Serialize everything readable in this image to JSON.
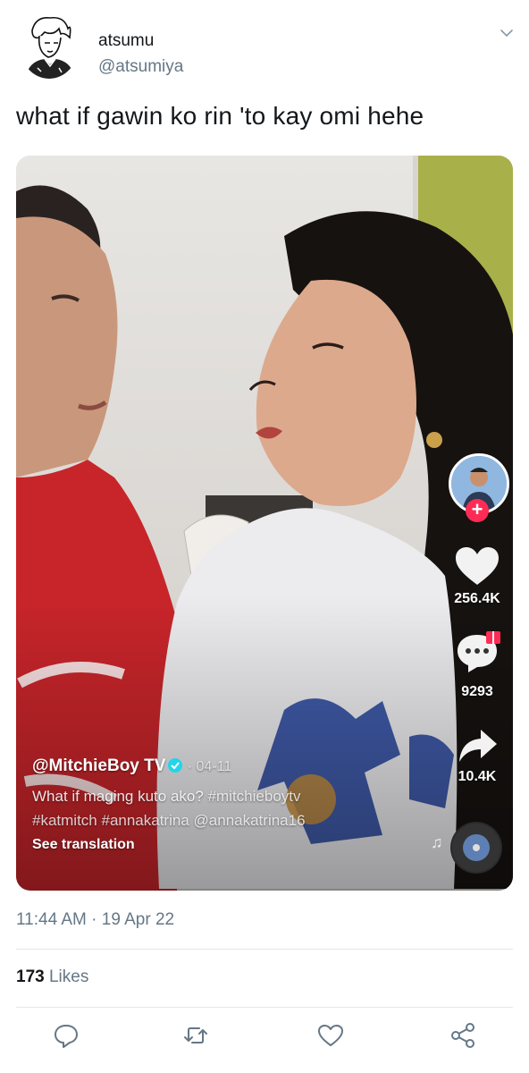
{
  "tweet": {
    "display_name": "atsumu",
    "handle": "@atsumiya",
    "text": "what if gawin ko rin 'to kay omi hehe",
    "timestamp": "11:44 AM · 19 Apr 22",
    "likes_count": "173",
    "likes_label": "Likes"
  },
  "video": {
    "username": "@MitchieBoy TV",
    "date": "· 04-11",
    "caption_text": "What if maging kuto ako?",
    "caption_tags": [
      "#mitchieboytv",
      "#katmitch",
      "#annakatrina",
      "@annakatrina16"
    ],
    "see_translation": "See translation",
    "like_count": "256.4K",
    "comment_count": "9293",
    "share_count": "10.4K"
  },
  "icons": {
    "chevron": "chevron-down-icon",
    "reply": "reply-icon",
    "retweet": "retweet-icon",
    "like": "heart-icon",
    "share": "share-icon"
  },
  "colors": {
    "muted_text": "#657786",
    "tiktok_red": "#fe2c55",
    "verified": "#20d5ec"
  }
}
